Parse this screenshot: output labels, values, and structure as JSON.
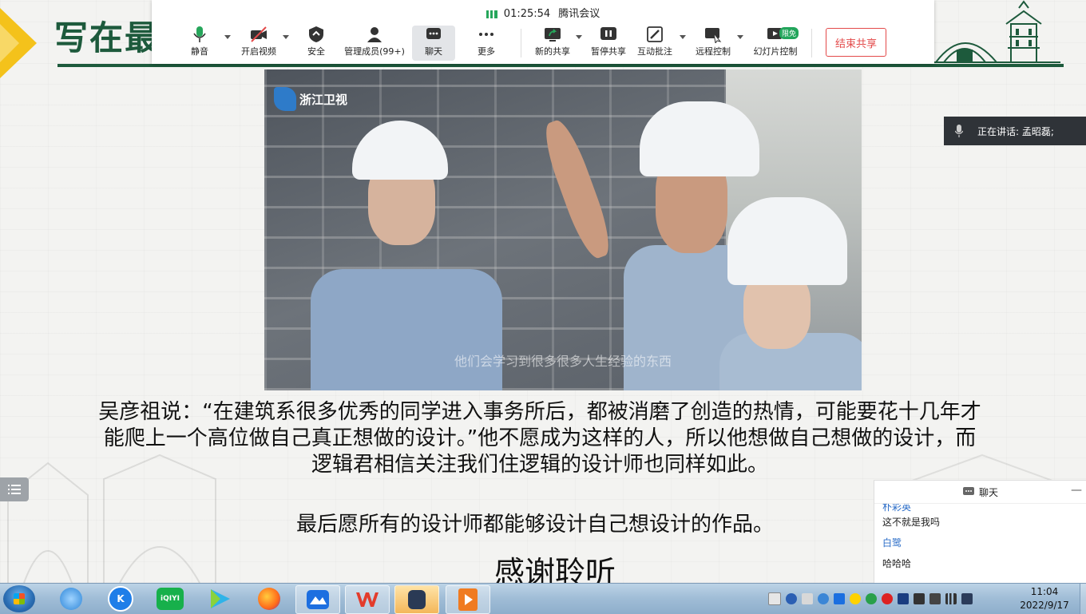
{
  "slide": {
    "title": "写在最",
    "quote": "吴彦祖说：“在建筑系很多优秀的同学进入事务所后，都被消磨了创造的热情，可能要花十几年才能爬上一个高位做自己真正想做的设计。”他不愿成为这样的人，所以他想做自己想做的设计，而逻辑君相信关注我们住逻辑的设计师也同样如此。",
    "wish": "最后愿所有的设计师都能够设计自己想设计的作品。",
    "thanks": "感谢聆听",
    "brand_color": "#1d5a3c",
    "accent_color": "#f4c21b"
  },
  "video": {
    "channel_logo": "浙江卫视",
    "subtitle": "他们会学习到很多很多人生经验的东西"
  },
  "meeting": {
    "timer": "01:25:54",
    "app_name": "腾讯会议",
    "buttons": {
      "mute": "静音",
      "video": "开启视频",
      "security": "安全",
      "members": "管理成员(99+)",
      "chat": "聊天",
      "more": "更多",
      "new_share": "新的共享",
      "pause_share": "暂停共享",
      "annotate": "互动批注",
      "remote": "远程控制",
      "slideshow": "幻灯片控制",
      "slideshow_badge": "限免",
      "end_share": "结束共享"
    },
    "speaker_label": "正在讲话: 孟昭磊;",
    "end_color": "#e34a4a",
    "signal_color": "#26a65b"
  },
  "chat": {
    "title": "聊天",
    "close": "—",
    "messages": [
      {
        "sender": "朴彩英",
        "text": "这不就是我吗"
      },
      {
        "sender": "白鹭",
        "text": "哈哈哈"
      }
    ]
  },
  "taskbar": {
    "clock_time": "11:04",
    "clock_date": "2022/9/17",
    "apps": [
      "browser-icon",
      "kugou-icon",
      "iqiyi-icon",
      "video-player-icon",
      "firefox-icon",
      "feishu-icon",
      "wps-icon",
      "tencent-meeting-icon",
      "ppt-icon"
    ],
    "iqiyi_label": "iQIYI",
    "kugou_label": "K"
  }
}
